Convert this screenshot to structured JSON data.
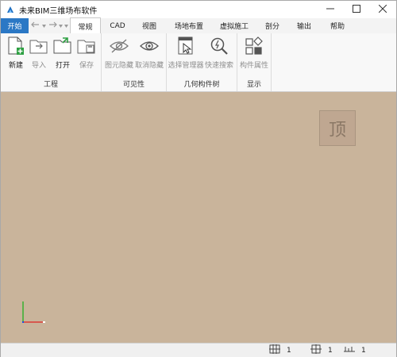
{
  "window": {
    "title": "未来BIM三维场布软件",
    "minimize_icon": "minimize-icon",
    "maximize_icon": "maximize-icon",
    "close_icon": "close-icon"
  },
  "tabs": {
    "start": "开始",
    "items": [
      "常规",
      "CAD",
      "视图",
      "场地布置",
      "虚拟施工",
      "剖分",
      "输出",
      "帮助"
    ],
    "active": "常规"
  },
  "ribbon": {
    "groups": [
      {
        "label": "工程",
        "buttons": [
          "新建",
          "导入",
          "打开",
          "保存"
        ]
      },
      {
        "label": "可见性",
        "buttons": [
          "图元隐藏",
          "取消隐藏"
        ]
      },
      {
        "label": "几何构件树",
        "buttons": [
          "选择管理器",
          "快速搜索"
        ]
      },
      {
        "label": "显示",
        "buttons": [
          "构件属性"
        ]
      }
    ]
  },
  "viewport": {
    "viewcube_label": "顶",
    "background_color": "#c9b49b"
  },
  "status": {
    "items": [
      "1",
      "1",
      "1"
    ]
  },
  "colors": {
    "start_tab": "#2b78c5",
    "axis_x": "#e02020",
    "axis_y": "#20b020"
  }
}
